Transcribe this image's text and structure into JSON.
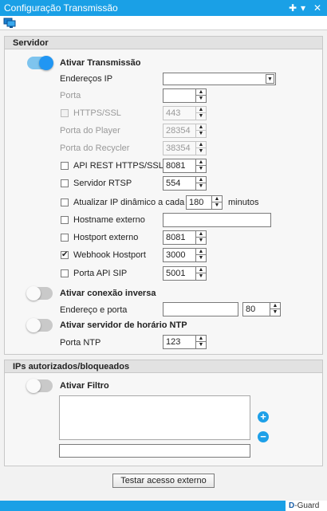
{
  "window": {
    "title": "Configuração Transmissão",
    "controls": {
      "pin": "✚",
      "collapse": "▾",
      "close": "✕"
    }
  },
  "toolbar": {
    "icon": "monitor-icon"
  },
  "servidor": {
    "header": "Servidor",
    "ativar_transmissao": {
      "label": "Ativar Transmissão",
      "on": true
    },
    "enderecos_ip": {
      "label": "Endereços IP",
      "value": ""
    },
    "porta": {
      "label": "Porta",
      "value": ""
    },
    "https_ssl": {
      "label": "HTTPS/SSL",
      "value": "443",
      "checked": false
    },
    "porta_player": {
      "label": "Porta do Player",
      "value": "28354"
    },
    "porta_recycler": {
      "label": "Porta do Recycler",
      "value": "38354"
    },
    "api_rest": {
      "label": "API REST HTTPS/SSL",
      "value": "8081",
      "checked": false
    },
    "servidor_rtsp": {
      "label": "Servidor RTSP",
      "value": "554",
      "checked": false
    },
    "atualizar_ip": {
      "label": "Atualizar IP dinâmico a cada",
      "value": "180",
      "unit": "minutos",
      "checked": false
    },
    "hostname_externo": {
      "label": "Hostname externo",
      "value": "",
      "checked": false
    },
    "hostport_externo": {
      "label": "Hostport externo",
      "value": "8081",
      "checked": false
    },
    "webhook_hostport": {
      "label": "Webhook Hostport",
      "value": "3000",
      "checked": true
    },
    "porta_api_sip": {
      "label": "Porta API SIP",
      "value": "5001",
      "checked": false
    },
    "conexao_inversa": {
      "label": "Ativar conexão inversa",
      "on": false
    },
    "endereco_porta": {
      "label": "Endereço e porta",
      "address": "",
      "port": "80"
    },
    "servidor_ntp": {
      "label": "Ativar servidor de horário NTP",
      "on": false
    },
    "porta_ntp": {
      "label": "Porta NTP",
      "value": "123"
    }
  },
  "ips": {
    "header": "IPs autorizados/bloqueados",
    "ativar_filtro": {
      "label": "Ativar Filtro",
      "on": false
    },
    "add": "+",
    "remove": "−",
    "entry_value": ""
  },
  "actions": {
    "testar": "Testar acesso externo"
  },
  "footer": {
    "brand_prefix": "D",
    "brand_suffix": "-Guard"
  },
  "colors": {
    "accent": "#1aa0e6",
    "toggle_on": "#2196f3"
  }
}
